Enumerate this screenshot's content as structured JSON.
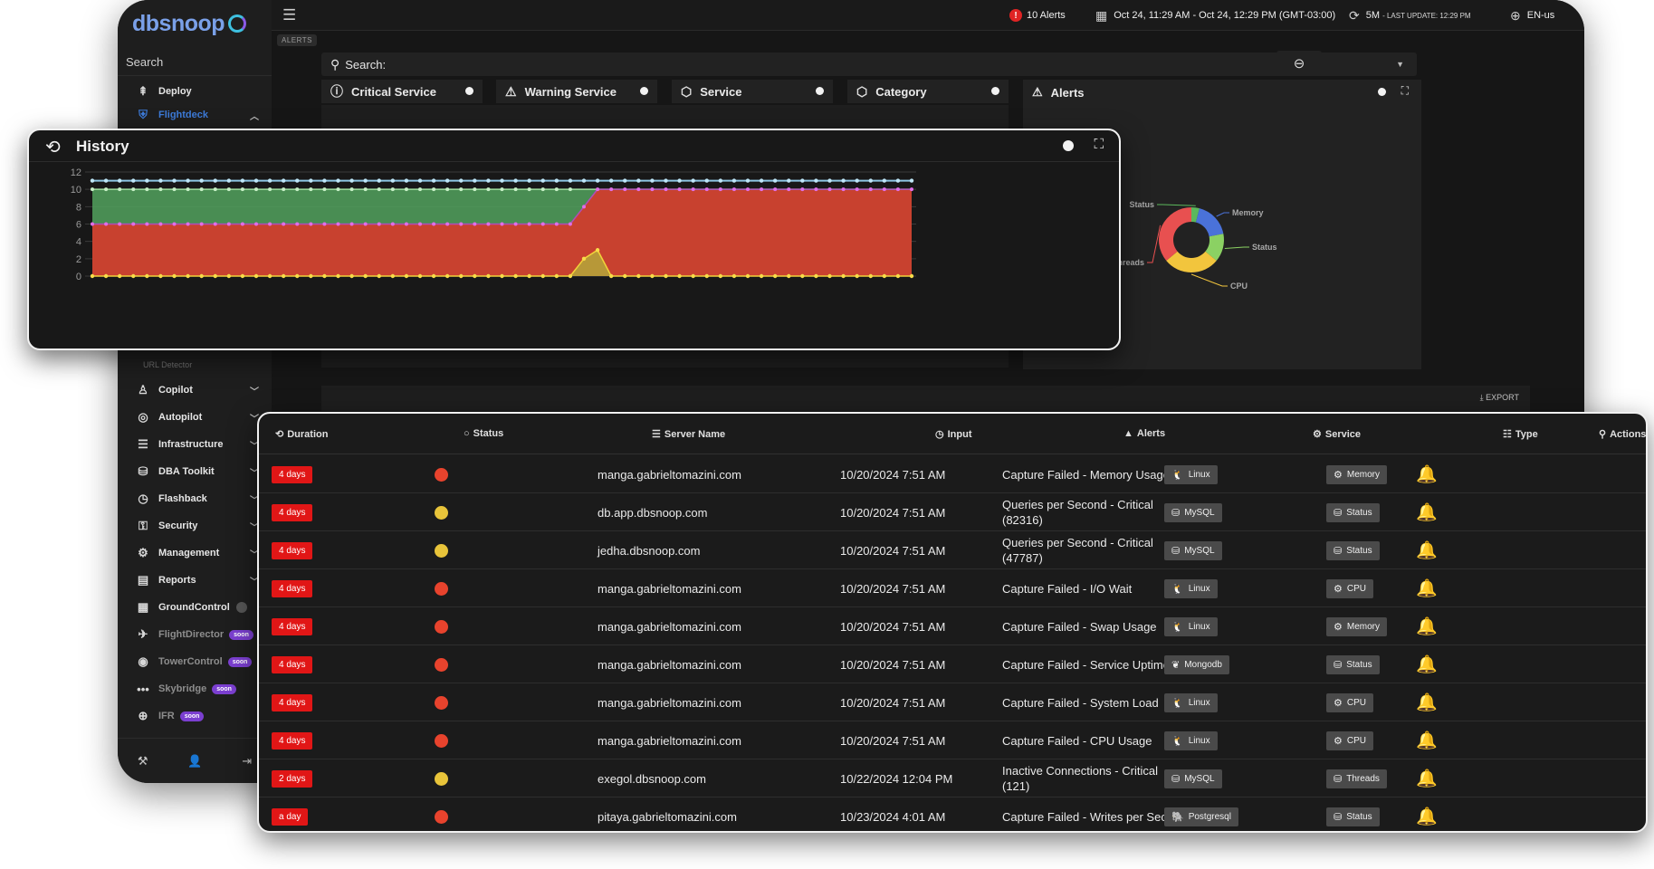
{
  "brand": {
    "name": "dbsnoop"
  },
  "sidebar": {
    "search_label": "Search",
    "top_items": [
      {
        "label": "Deploy",
        "icon": "deploy-icon"
      },
      {
        "label": "Flightdeck",
        "icon": "shield-icon"
      }
    ],
    "sub_label": "URL Detector",
    "items": [
      {
        "label": "Copilot",
        "icon": "copilot-icon"
      },
      {
        "label": "Autopilot",
        "icon": "autopilot-icon"
      },
      {
        "label": "Infrastructure",
        "icon": "server-icon"
      },
      {
        "label": "DBA Toolkit",
        "icon": "database-icon"
      },
      {
        "label": "Flashback",
        "icon": "clock-icon"
      },
      {
        "label": "Security",
        "icon": "lock-icon"
      },
      {
        "label": "Management",
        "icon": "gear-icon"
      },
      {
        "label": "Reports",
        "icon": "report-icon"
      }
    ],
    "groundcontrol_label": "GroundControl",
    "soon_items": [
      {
        "label": "FlightDirector",
        "badge": "soon"
      },
      {
        "label": "TowerControl",
        "badge": "soon"
      },
      {
        "label": "Skybridge",
        "badge": "soon"
      },
      {
        "label": "IFR",
        "badge": "soon"
      }
    ]
  },
  "topbar": {
    "alerts": "10 Alerts",
    "date_range": "Oct 24, 11:29 AM - Oct 24, 12:29 PM (GMT-03:00)",
    "refresh": "5M",
    "last_update": "- LAST UPDATE: 12:29 PM",
    "language": "EN-us"
  },
  "breadcrumb": "ALERTS",
  "search": {
    "label": "Search:"
  },
  "filter_cards": [
    {
      "label": "Critical Service"
    },
    {
      "label": "Warning Service"
    },
    {
      "label": "Service"
    },
    {
      "label": "Category"
    }
  ],
  "alerts_panel": {
    "title": "Alerts",
    "chart_data": {
      "type": "pie",
      "labels": [
        "Status",
        "Memory",
        "Status",
        "CPU",
        "Threads"
      ],
      "values": [
        4,
        18,
        14,
        28,
        36
      ],
      "colors": [
        "#5cb85c",
        "#4a72d9",
        "#8bd163",
        "#f2c53d",
        "#e85050"
      ]
    }
  },
  "export_label": "EXPORT",
  "history": {
    "title": "History",
    "chart_data": {
      "type": "area",
      "x_points": 61,
      "ylim": [
        0,
        12
      ],
      "y_ticks": [
        0,
        2,
        4,
        6,
        8,
        10,
        12
      ],
      "series": [
        {
          "color": "#d6402f",
          "values": "6 for points 0-35, rising to 10 by point 37, then 10"
        },
        {
          "color": "#4f9a5a",
          "values": "10 for points 0-35, then overlapped"
        },
        {
          "color": "#9bd0ea",
          "values": "11 constant"
        },
        {
          "color": "#c8b33a",
          "values": "0, spike to 2 at point 36 and 3 at point 37"
        }
      ]
    }
  },
  "table": {
    "headers": {
      "duration": "Duration",
      "status": "Status",
      "server": "Server Name",
      "input": "Input",
      "alerts": "Alerts",
      "service": "Service",
      "type": "Type",
      "actions": "Actions"
    },
    "rows": [
      {
        "duration": "4 days",
        "status": "#e8432d",
        "server": "manga.gabrieltomazini.com",
        "input": "10/20/2024 7:51 AM",
        "alert": "Capture Failed - Memory Usage",
        "service": "Linux",
        "service_icon": "linux-icon",
        "type": "Memory",
        "type_icon": "memory-icon"
      },
      {
        "duration": "4 days",
        "status": "#e8c43a",
        "server": "db.app.dbsnoop.com",
        "input": "10/20/2024 7:51 AM",
        "alert": "Queries per Second - Critical (82316)",
        "service": "MySQL",
        "service_icon": "mysql-icon",
        "type": "Status",
        "type_icon": "status-icon"
      },
      {
        "duration": "4 days",
        "status": "#e8c43a",
        "server": "jedha.dbsnoop.com",
        "input": "10/20/2024 7:51 AM",
        "alert": "Queries per Second - Critical (47787)",
        "service": "MySQL",
        "service_icon": "mysql-icon",
        "type": "Status",
        "type_icon": "status-icon"
      },
      {
        "duration": "4 days",
        "status": "#e8432d",
        "server": "manga.gabrieltomazini.com",
        "input": "10/20/2024 7:51 AM",
        "alert": "Capture Failed - I/O Wait",
        "service": "Linux",
        "service_icon": "linux-icon",
        "type": "CPU",
        "type_icon": "cpu-icon"
      },
      {
        "duration": "4 days",
        "status": "#e8432d",
        "server": "manga.gabrieltomazini.com",
        "input": "10/20/2024 7:51 AM",
        "alert": "Capture Failed - Swap Usage",
        "service": "Linux",
        "service_icon": "linux-icon",
        "type": "Memory",
        "type_icon": "memory-icon"
      },
      {
        "duration": "4 days",
        "status": "#e8432d",
        "server": "manga.gabrieltomazini.com",
        "input": "10/20/2024 7:51 AM",
        "alert": "Capture Failed - Service Uptime",
        "service": "Mongodb",
        "service_icon": "mongodb-icon",
        "type": "Status",
        "type_icon": "status-icon"
      },
      {
        "duration": "4 days",
        "status": "#e8432d",
        "server": "manga.gabrieltomazini.com",
        "input": "10/20/2024 7:51 AM",
        "alert": "Capture Failed - System Load",
        "service": "Linux",
        "service_icon": "linux-icon",
        "type": "CPU",
        "type_icon": "cpu-icon"
      },
      {
        "duration": "4 days",
        "status": "#e8432d",
        "server": "manga.gabrieltomazini.com",
        "input": "10/20/2024 7:51 AM",
        "alert": "Capture Failed - CPU Usage",
        "service": "Linux",
        "service_icon": "linux-icon",
        "type": "CPU",
        "type_icon": "cpu-icon"
      },
      {
        "duration": "2 days",
        "status": "#e8c43a",
        "server": "exegol.dbsnoop.com",
        "input": "10/22/2024 12:04 PM",
        "alert": "Inactive Connections - Critical (121)",
        "service": "MySQL",
        "service_icon": "mysql-icon",
        "type": "Threads",
        "type_icon": "threads-icon"
      },
      {
        "duration": "a day",
        "status": "#e8432d",
        "server": "pitaya.gabrieltomazini.com",
        "input": "10/23/2024 4:01 AM",
        "alert": "Capture Failed - Writes per Second",
        "service": "Postgresql",
        "service_icon": "postgresql-icon",
        "type": "Status",
        "type_icon": "status-icon"
      }
    ]
  }
}
